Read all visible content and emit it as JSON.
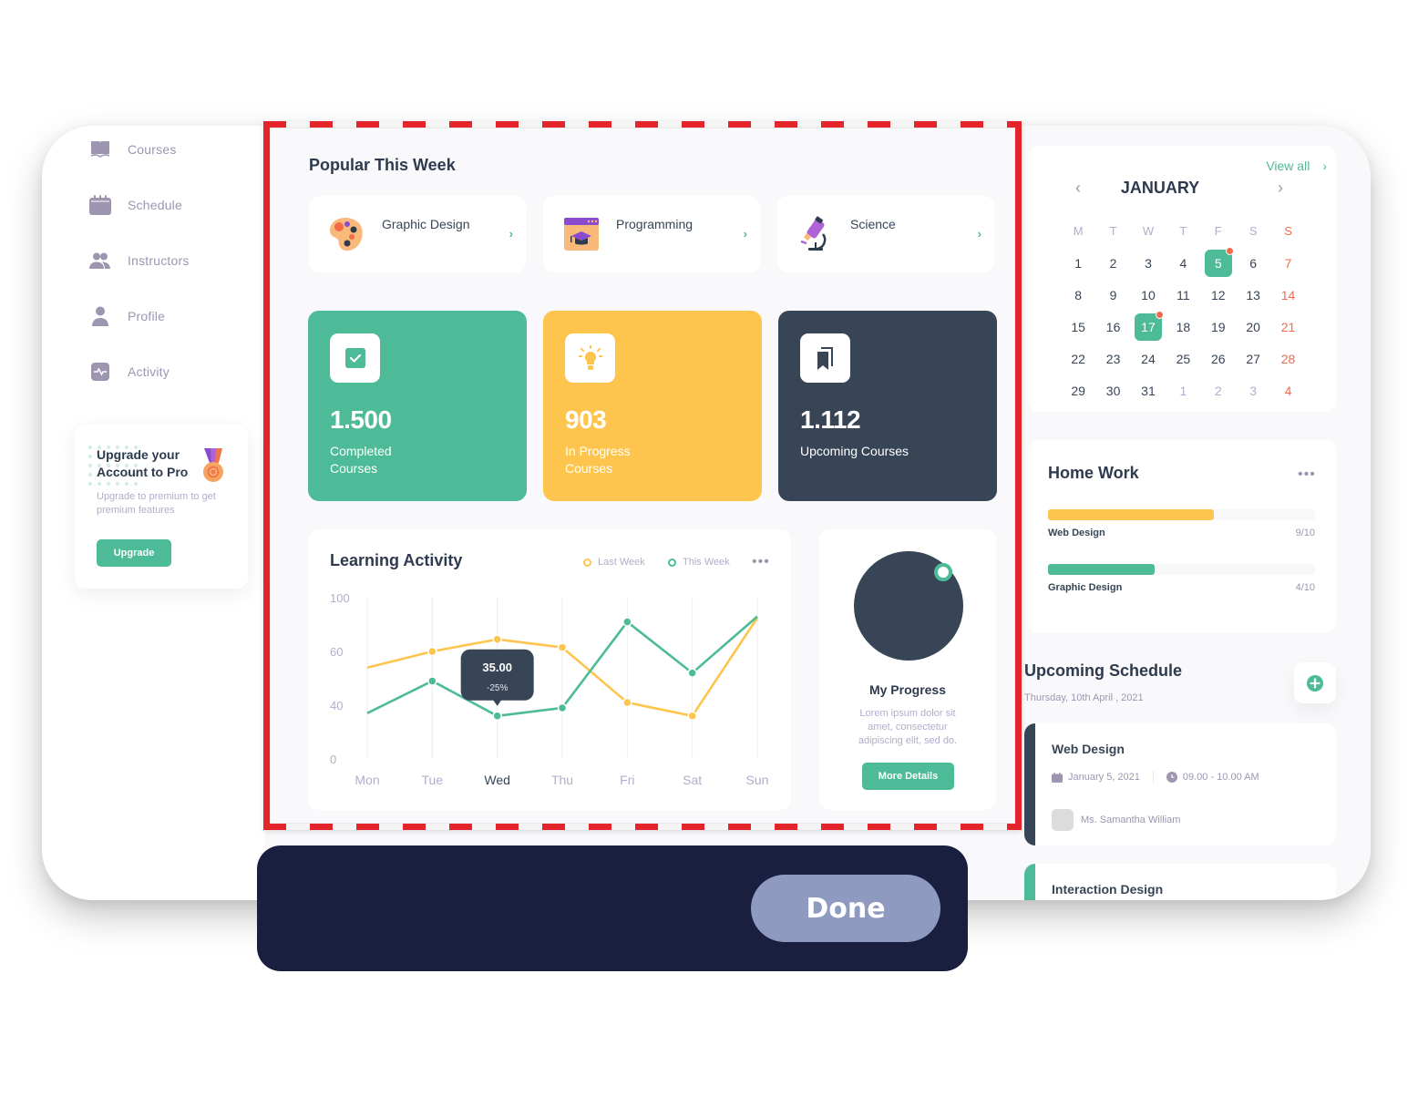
{
  "sidebar": {
    "items": [
      {
        "label": "Courses",
        "icon": "book-icon"
      },
      {
        "label": "Schedule",
        "icon": "calendar-icon"
      },
      {
        "label": "Instructors",
        "icon": "users-icon"
      },
      {
        "label": "Profile",
        "icon": "user-icon"
      },
      {
        "label": "Activity",
        "icon": "activity-icon"
      }
    ],
    "upgrade": {
      "title": "Upgrade your Account to Pro",
      "subtitle": "Upgrade to premium to get premium features",
      "button": "Upgrade"
    }
  },
  "popular": {
    "title": "Popular This Week",
    "items": [
      {
        "label": "Graphic Design",
        "icon": "palette-icon"
      },
      {
        "label": "Programming",
        "icon": "graduation-window-icon"
      },
      {
        "label": "Science",
        "icon": "microscope-icon"
      }
    ]
  },
  "stats": [
    {
      "value": "1.500",
      "label": "Completed Courses",
      "color": "#4dba98",
      "icon": "checkbox-icon"
    },
    {
      "value": "903",
      "label": "In Progress Courses",
      "color": "#fec54e",
      "icon": "lightbulb-icon"
    },
    {
      "value": "1.112",
      "label": "Upcoming Courses",
      "color": "#374557",
      "icon": "bookmarks-icon"
    }
  ],
  "activity": {
    "title": "Learning Activity",
    "legend": [
      "Last Week",
      "This Week"
    ],
    "tooltip": {
      "value": "35.00",
      "change": "-25%"
    },
    "highlight_day": "Wed"
  },
  "chart_data": {
    "type": "line",
    "title": "Learning Activity",
    "categories": [
      "Mon",
      "Tue",
      "Wed",
      "Thu",
      "Fri",
      "Sat",
      "Sun"
    ],
    "y_ticks": [
      0,
      40,
      60,
      100
    ],
    "series": [
      {
        "name": "Last Week",
        "color": "#fec54e",
        "values": [
          54,
          60,
          69,
          63,
          41,
          32,
          85
        ]
      },
      {
        "name": "This Week",
        "color": "#4dba98",
        "values": [
          34,
          49,
          32,
          38,
          82,
          52,
          86
        ]
      }
    ],
    "legend_position": "top-right",
    "grid": "vertical"
  },
  "progress": {
    "title": "My Progress",
    "description": "Lorem ipsum dolor sit amet, consectetur adipiscing elit, sed do.",
    "button": "More Details"
  },
  "calendar": {
    "view_all": "View all",
    "month": "JANUARY",
    "weekdays": [
      "M",
      "T",
      "W",
      "T",
      "F",
      "S",
      "S"
    ],
    "weeks": [
      [
        "1",
        "2",
        "3",
        "4",
        "5",
        "6",
        "7"
      ],
      [
        "8",
        "9",
        "10",
        "11",
        "12",
        "13",
        "14"
      ],
      [
        "15",
        "16",
        "17",
        "18",
        "19",
        "20",
        "21"
      ],
      [
        "22",
        "23",
        "24",
        "25",
        "26",
        "27",
        "28"
      ],
      [
        "29",
        "30",
        "31",
        "1",
        "2",
        "3",
        "4"
      ]
    ],
    "selected_days": [
      "5",
      "17"
    ]
  },
  "homework": {
    "title": "Home Work",
    "items": [
      {
        "label": "Web Design",
        "value": "9/10",
        "fill": 0.62,
        "color": "#fec54e"
      },
      {
        "label": "Graphic Design",
        "value": "4/10",
        "fill": 0.4,
        "color": "#4dba98"
      }
    ]
  },
  "schedule": {
    "title": "Upcoming Schedule",
    "date": "Thursday, 10th April , 2021",
    "items": [
      {
        "title": "Web Design",
        "date": "January 5, 2021",
        "time": "09.00 - 10.00 AM",
        "instructor": "Ms. Samantha William",
        "color": "#374557"
      },
      {
        "title": "Interaction Design",
        "color": "#4dba98"
      }
    ]
  },
  "overlay": {
    "done": "Done"
  }
}
